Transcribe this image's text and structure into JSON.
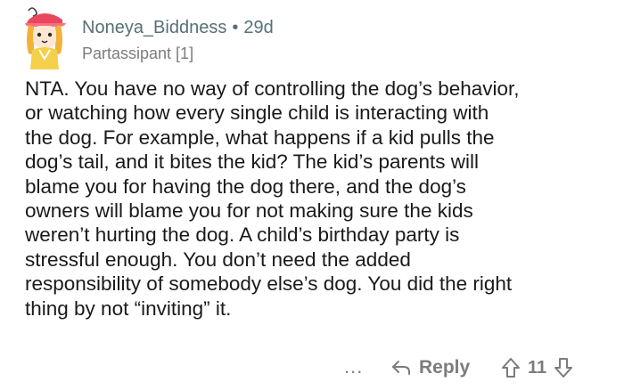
{
  "comment": {
    "username": "Noneya_Biddness",
    "separator": "•",
    "age": "29d",
    "flair": "Partassipant [1]",
    "body_lines": [
      "NTA. You have no way of controlling the dog’s behavior,",
      "or watching how every single child is interacting with",
      "the dog. For example, what happens if a kid pulls the",
      "dog’s tail, and it bites the kid? The kid’s parents will",
      "blame you for having the dog there, and the dog’s",
      "owners will blame you for not making sure the kids",
      "weren’t hurting the dog. A child’s birthday party is",
      "stressful enough. You don’t need the added",
      "responsibility of somebody else’s dog. You did the right",
      "thing by not “inviting” it."
    ]
  },
  "actions": {
    "more_label": "...",
    "reply_label": "Reply",
    "vote_count": "11"
  },
  "icons": {
    "more": "more-options-icon",
    "reply": "reply-arrow-icon",
    "upvote": "upvote-arrow-icon",
    "downvote": "downvote-arrow-icon"
  },
  "colors": {
    "text": "#1a1a1b",
    "meta": "#576f76",
    "muted": "#7c7c7c",
    "avatar_hat": "#e8475f",
    "avatar_hair": "#f2b23a"
  }
}
